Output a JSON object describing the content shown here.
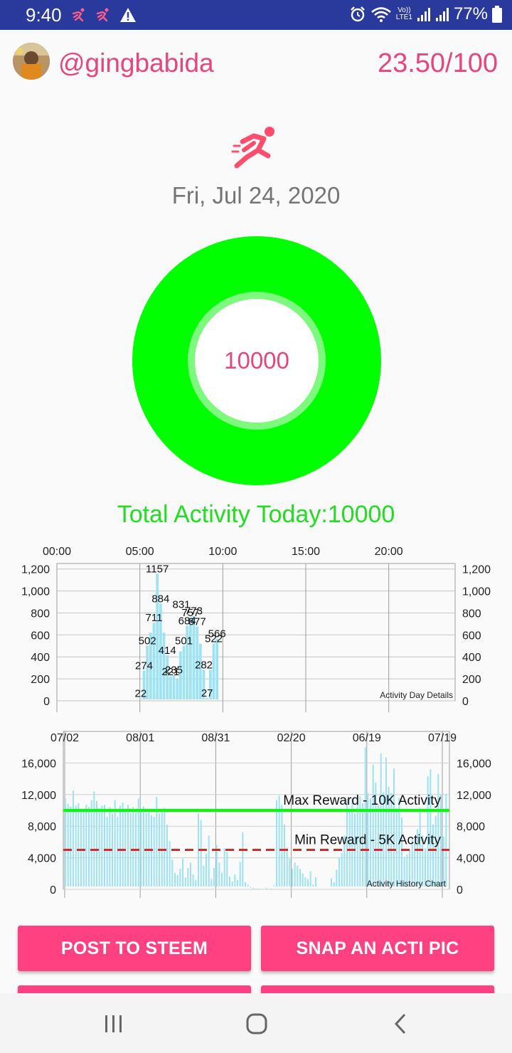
{
  "status_bar": {
    "time": "9:40",
    "lte_top": "Vo))",
    "lte_bottom": "LTE1",
    "battery": "77%",
    "icons": [
      "runner-notification-icon",
      "runner-notification-icon",
      "warning-icon",
      "alarm-icon",
      "wifi-icon",
      "signal-icon",
      "signal-icon",
      "battery-icon"
    ]
  },
  "header": {
    "username": "@gingbabida",
    "score": "23.50/100"
  },
  "date": "Fri, Jul 24, 2020",
  "donut": {
    "value": "10000",
    "progress": 1.0,
    "color": "#00ff00"
  },
  "total_activity": "Total Activity Today:10000",
  "colors": {
    "accent": "#e8457f",
    "button": "#ff4081",
    "green": "#00ff00",
    "bar": "#9be3f5",
    "min_line": "#d62a2a"
  },
  "chart_data": [
    {
      "type": "bar",
      "title": "Activity Day Details",
      "x_ticks": [
        "00:00",
        "05:00",
        "10:00",
        "15:00",
        "20:00"
      ],
      "y_ticks": [
        "1,200",
        "1,000",
        "800",
        "600",
        "400",
        "200",
        "0"
      ],
      "ylim": [
        0,
        1250
      ],
      "xlim_hours": [
        0,
        24
      ],
      "grid": true,
      "x_hours": [
        5.05,
        5.25,
        5.45,
        5.65,
        5.85,
        6.05,
        6.25,
        6.45,
        6.65,
        6.85,
        7.05,
        7.25,
        7.45,
        7.65,
        7.85,
        8.05,
        8.25,
        8.45,
        8.65,
        8.85,
        9.05,
        9.25,
        9.45,
        9.65
      ],
      "values": [
        22,
        274,
        502,
        620,
        711,
        1157,
        884,
        620,
        414,
        221,
        235,
        200,
        450,
        501,
        684,
        757,
        773,
        677,
        520,
        282,
        27,
        282,
        522,
        566
      ],
      "labels": [
        {
          "text": "1157",
          "x": 6.05,
          "y": 1157
        },
        {
          "text": "884",
          "x": 6.25,
          "y": 884
        },
        {
          "text": "711",
          "x": 5.85,
          "y": 711
        },
        {
          "text": "502",
          "x": 5.45,
          "y": 502
        },
        {
          "text": "414",
          "x": 6.65,
          "y": 414
        },
        {
          "text": "274",
          "x": 5.25,
          "y": 274
        },
        {
          "text": "22",
          "x": 5.05,
          "y": 22
        },
        {
          "text": "235",
          "x": 7.05,
          "y": 235
        },
        {
          "text": "221",
          "x": 6.85,
          "y": 221
        },
        {
          "text": "501",
          "x": 7.65,
          "y": 501
        },
        {
          "text": "831",
          "x": 7.5,
          "y": 831
        },
        {
          "text": "684",
          "x": 7.85,
          "y": 684
        },
        {
          "text": "757",
          "x": 8.05,
          "y": 757
        },
        {
          "text": "773",
          "x": 8.25,
          "y": 773
        },
        {
          "text": "677",
          "x": 8.45,
          "y": 677
        },
        {
          "text": "282",
          "x": 8.85,
          "y": 282
        },
        {
          "text": "27",
          "x": 9.05,
          "y": 27
        },
        {
          "text": "522",
          "x": 9.45,
          "y": 522
        },
        {
          "text": "566",
          "x": 9.65,
          "y": 566
        }
      ]
    },
    {
      "type": "bar",
      "title": "Activity History Chart",
      "x_ticks": [
        "07/02",
        "08/01",
        "08/31",
        "02/20",
        "06/19",
        "07/19"
      ],
      "y_ticks": [
        "16,000",
        "12,000",
        "8,000",
        "4,000",
        "0"
      ],
      "ylim": [
        0,
        20000
      ],
      "grid": true,
      "values": [
        11500,
        10800,
        10500,
        12500,
        10600,
        10900,
        10200,
        9800,
        10700,
        10400,
        11300,
        12400,
        11200,
        10300,
        10600,
        10700,
        9200,
        10400,
        9600,
        11300,
        9200,
        10600,
        11000,
        10200,
        10700,
        9600,
        10400,
        9700,
        11500,
        10200,
        10500,
        9600,
        10000,
        9400,
        9200,
        11700,
        9600,
        10200,
        10300,
        8200,
        6100,
        3800,
        2100,
        1800,
        2600,
        3900,
        1500,
        2700,
        3400,
        1900,
        1200,
        9600,
        8800,
        3000,
        4500,
        6800,
        1300,
        2700,
        5600,
        3400,
        2100,
        5200,
        4700,
        1600,
        1000,
        1900,
        1200,
        3500,
        7200,
        900,
        600,
        300,
        200,
        100,
        100,
        0,
        0,
        200,
        0,
        100,
        500,
        11300,
        11900,
        10700,
        8200,
        5300,
        3900,
        2600,
        3400,
        3000,
        2600,
        2000,
        1500,
        1300,
        2300,
        600,
        1500,
        0,
        0,
        0,
        0,
        0,
        1400,
        900,
        2500,
        4000,
        4600,
        6800,
        11400,
        10200,
        11600,
        9600,
        12000,
        11800,
        10900,
        18000,
        12200,
        11500,
        15800,
        13500,
        10700,
        17200,
        12300,
        16700,
        13000,
        12200,
        15300,
        10300,
        11600,
        9100,
        4100,
        4400,
        5100,
        6500,
        5900,
        7600,
        10300,
        6800,
        5200,
        14300,
        15200,
        8200,
        9300,
        14600,
        12000,
        6700,
        12100
      ],
      "reference_lines": [
        {
          "label": "Max Reward - 10K Activity",
          "value": 10000,
          "style": "solid",
          "color": "#00ff00"
        },
        {
          "label": "Min Reward - 5K Activity",
          "value": 5000,
          "style": "dashed",
          "color": "#d62a2a"
        }
      ]
    }
  ],
  "buttons": {
    "post_to_steem": "POST TO STEEM",
    "snap_an_acti_pic": "SNAP AN ACTI PIC"
  },
  "navbar": {
    "icons": [
      "recent-apps-icon",
      "home-icon",
      "back-icon"
    ]
  }
}
